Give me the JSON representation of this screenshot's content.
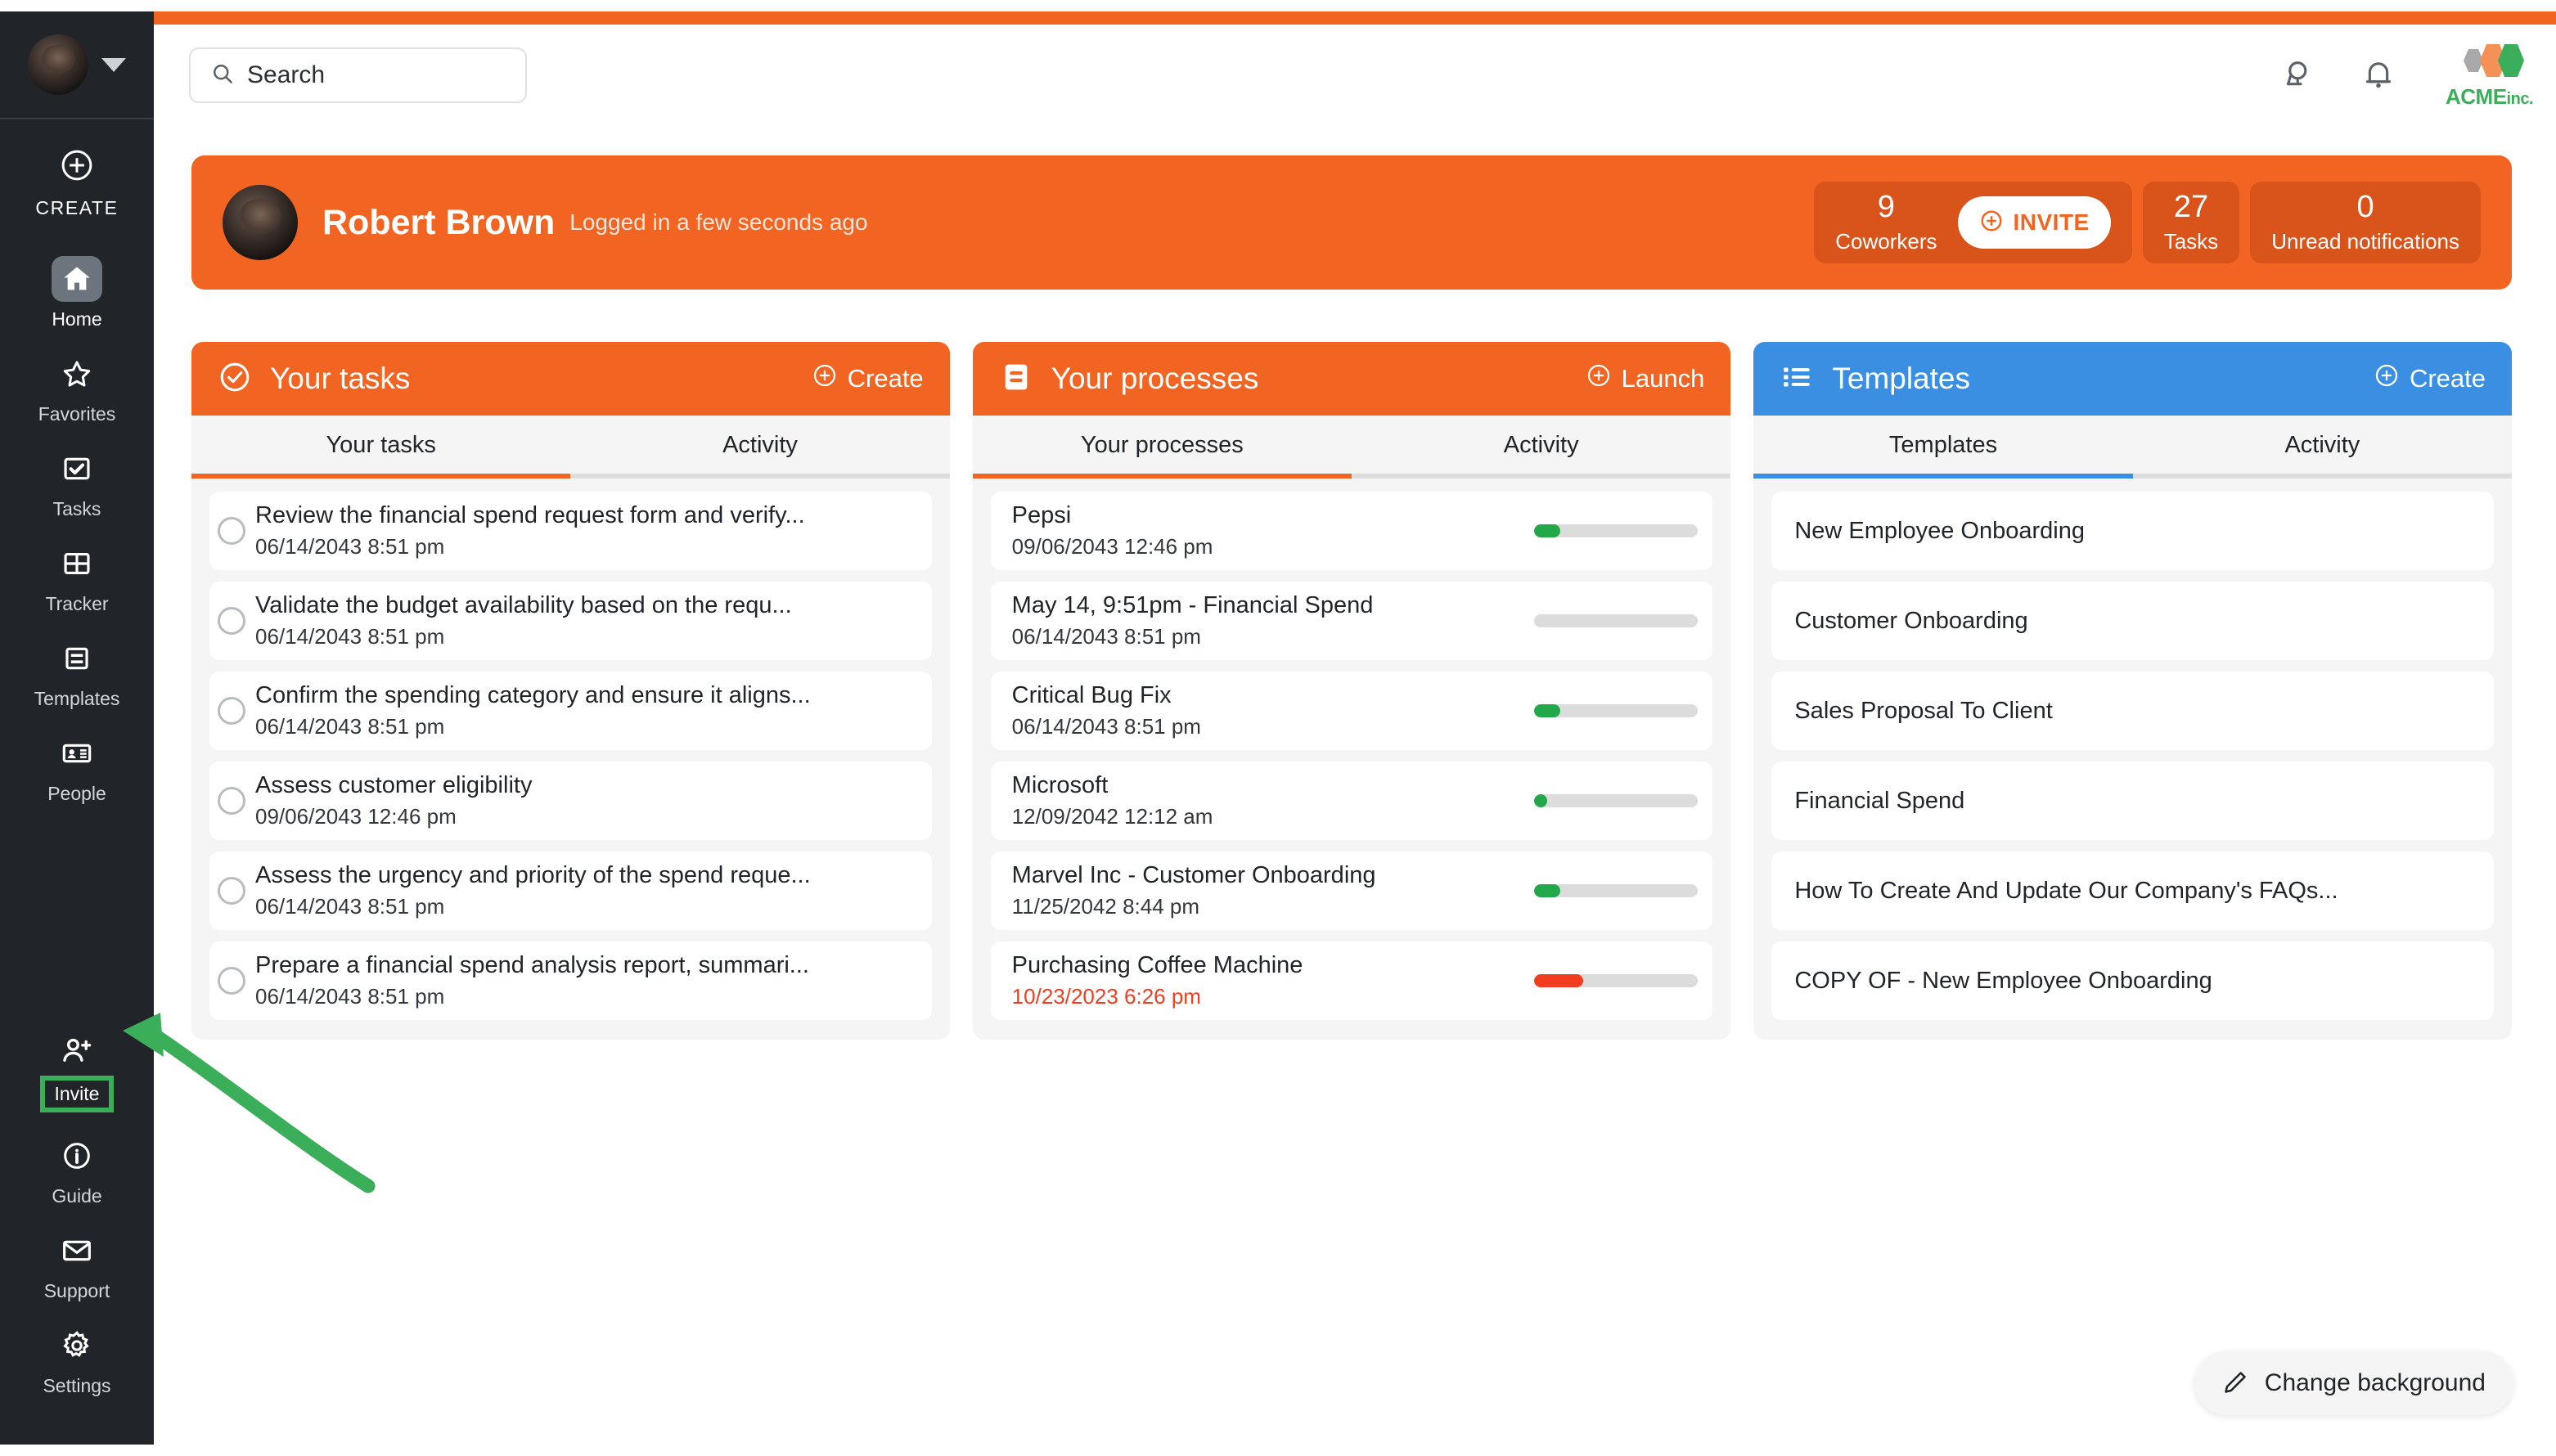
{
  "brand": {
    "orange": "#F26422",
    "blue": "#3B8FE3",
    "green": "#3BAE5A",
    "red": "#F03E1E",
    "sidebar_bg": "#212529"
  },
  "sidebar": {
    "create_label": "CREATE",
    "items": [
      {
        "label": "Home",
        "icon": "home-icon",
        "active": true
      },
      {
        "label": "Favorites",
        "icon": "star-icon",
        "active": false
      },
      {
        "label": "Tasks",
        "icon": "checkbox-icon",
        "active": false
      },
      {
        "label": "Tracker",
        "icon": "grid-icon",
        "active": false
      },
      {
        "label": "Templates",
        "icon": "templates-icon",
        "active": false
      },
      {
        "label": "People",
        "icon": "contact-card-icon",
        "active": false
      }
    ],
    "bottom_items": [
      {
        "label": "Invite",
        "icon": "user-plus-icon",
        "highlighted": true
      },
      {
        "label": "Guide",
        "icon": "info-icon",
        "highlighted": false
      },
      {
        "label": "Support",
        "icon": "envelope-icon",
        "highlighted": false
      },
      {
        "label": "Settings",
        "icon": "gear-icon",
        "highlighted": false
      }
    ]
  },
  "header": {
    "search_placeholder": "Search",
    "globe_icon": "globe-icon",
    "bell_icon": "bell-icon",
    "logo_name": "ACME",
    "logo_suffix": "inc."
  },
  "banner": {
    "user_name": "Robert Brown",
    "login_status": "Logged in a few seconds ago",
    "stats": [
      {
        "value": "9",
        "label": "Coworkers"
      },
      {
        "value": "27",
        "label": "Tasks"
      },
      {
        "value": "0",
        "label": "Unread notifications"
      }
    ],
    "invite_button": "INVITE"
  },
  "cards": [
    {
      "title": "Your tasks",
      "icon": "check-circle-icon",
      "action": "Create",
      "action_icon": "plus-circle-icon",
      "accent": "orange",
      "tabs": [
        {
          "label": "Your tasks",
          "active": true
        },
        {
          "label": "Activity",
          "active": false
        }
      ],
      "rows": [
        {
          "title": "Review the financial spend request form and verify...",
          "sub": "06/14/2043 8:51 pm",
          "overdue": false
        },
        {
          "title": "Validate the budget availability based on the requ...",
          "sub": "06/14/2043 8:51 pm",
          "overdue": false
        },
        {
          "title": "Confirm the spending category and ensure it aligns...",
          "sub": "06/14/2043 8:51 pm",
          "overdue": false
        },
        {
          "title": "Assess customer eligibility",
          "sub": "09/06/2043 12:46 pm",
          "overdue": false
        },
        {
          "title": "Assess the urgency and priority of the spend reque...",
          "sub": "06/14/2043 8:51 pm",
          "overdue": false
        },
        {
          "title": "Prepare a financial spend analysis report, summari...",
          "sub": "06/14/2043 8:51 pm",
          "overdue": false
        }
      ]
    },
    {
      "title": "Your processes",
      "icon": "process-icon",
      "action": "Launch",
      "action_icon": "plus-circle-icon",
      "accent": "orange",
      "tabs": [
        {
          "label": "Your processes",
          "active": true
        },
        {
          "label": "Activity",
          "active": false
        }
      ],
      "rows": [
        {
          "title": "Pepsi",
          "sub": "09/06/2043 12:46 pm",
          "overdue": false,
          "progress": 16,
          "progress_color": "#22A84B"
        },
        {
          "title": "May 14, 9:51pm - Financial Spend",
          "sub": "06/14/2043 8:51 pm",
          "overdue": false,
          "progress": 0,
          "progress_color": "#22A84B"
        },
        {
          "title": "Critical Bug Fix",
          "sub": "06/14/2043 8:51 pm",
          "overdue": false,
          "progress": 16,
          "progress_color": "#22A84B"
        },
        {
          "title": "Microsoft",
          "sub": "12/09/2042 12:12 am",
          "overdue": false,
          "progress": 8,
          "progress_color": "#22A84B"
        },
        {
          "title": "Marvel Inc - Customer Onboarding",
          "sub": "11/25/2042 8:44 pm",
          "overdue": false,
          "progress": 16,
          "progress_color": "#22A84B"
        },
        {
          "title": "Purchasing Coffee Machine",
          "sub": "10/23/2023 6:26 pm",
          "overdue": true,
          "progress": 30,
          "progress_color": "#F03E1E"
        }
      ]
    },
    {
      "title": "Templates",
      "icon": "list-icon",
      "action": "Create",
      "action_icon": "plus-circle-icon",
      "accent": "blue",
      "tabs": [
        {
          "label": "Templates",
          "active": true
        },
        {
          "label": "Activity",
          "active": false
        }
      ],
      "rows": [
        {
          "title": "New Employee Onboarding"
        },
        {
          "title": "Customer Onboarding"
        },
        {
          "title": "Sales Proposal To Client"
        },
        {
          "title": "Financial Spend"
        },
        {
          "title": "How To Create And Update Our Company's FAQs..."
        },
        {
          "title": "COPY OF - New Employee Onboarding"
        }
      ]
    }
  ],
  "change_background": {
    "label": "Change background",
    "icon": "pencil-icon"
  }
}
